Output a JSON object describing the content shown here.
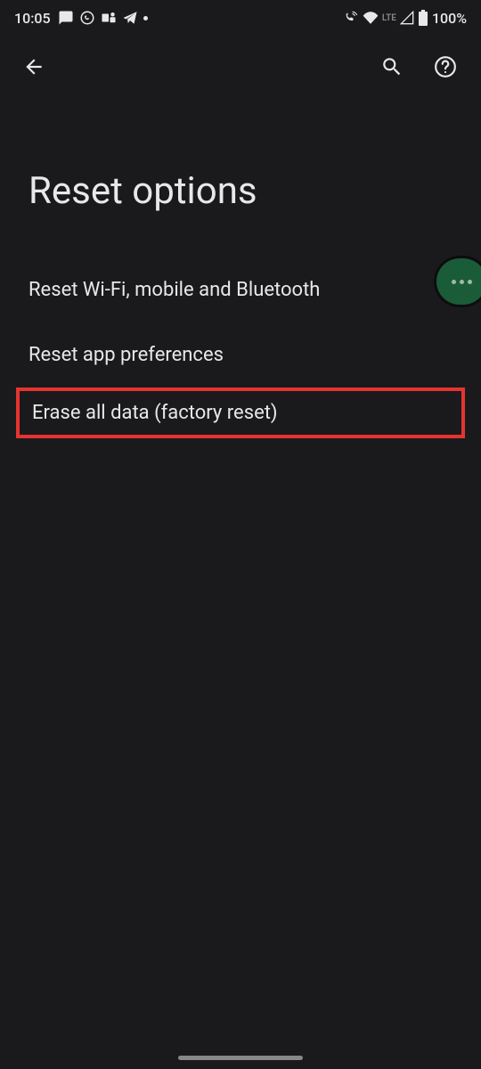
{
  "status_bar": {
    "time": "10:05",
    "battery_text": "100%",
    "network_label": "LTE"
  },
  "app_bar": {},
  "page": {
    "title": "Reset options"
  },
  "options": [
    {
      "label": "Reset Wi-Fi, mobile and Bluetooth"
    },
    {
      "label": "Reset app preferences"
    },
    {
      "label": "Erase all data (factory reset)"
    }
  ]
}
